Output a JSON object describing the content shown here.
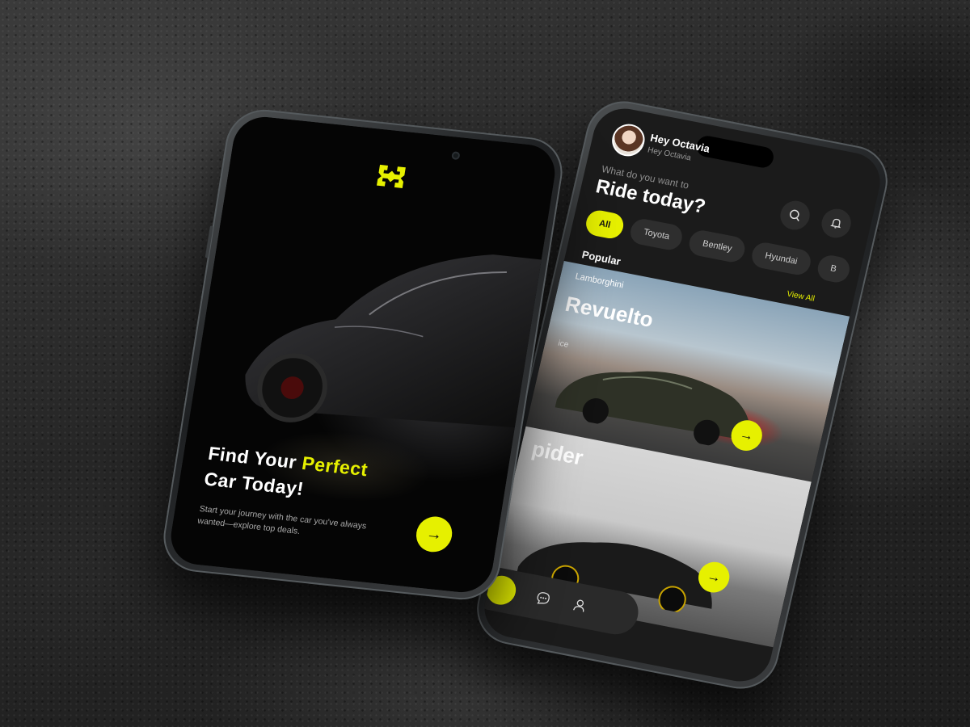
{
  "splash": {
    "title_part1": "Find Your ",
    "title_accent": "Perfect",
    "title_part2": "Car Today!",
    "subtitle": "Start your journey with the car you've always wanted—explore top deals.",
    "cta_icon": "arrow-right-icon",
    "cta_glyph": "→"
  },
  "home": {
    "greeting": "Hey Octavia",
    "greeting_sub": "Hey Octavia",
    "question_sub": "What do you want to",
    "question_title": "Ride today?",
    "search_icon": "search-icon",
    "bell_icon": "bell-icon",
    "chips": [
      {
        "label": "All",
        "active": true
      },
      {
        "label": "Toyota",
        "active": false
      },
      {
        "label": "Bentley",
        "active": false
      },
      {
        "label": "Hyundai",
        "active": false
      },
      {
        "label": "B",
        "active": false
      }
    ],
    "section_title": "Popular",
    "view_all": "View All",
    "cards": [
      {
        "brand": "Lamborghini",
        "model": "Revuelto",
        "spec": "ice",
        "cta_glyph": "→"
      },
      {
        "brand": "",
        "model": "pider",
        "spec": "",
        "cta_glyph": "→"
      }
    ],
    "nav": [
      {
        "icon": "home-icon"
      },
      {
        "icon": "chat-icon"
      },
      {
        "icon": "profile-icon"
      }
    ]
  },
  "colors": {
    "accent": "#e6f000",
    "screen_bg": "#1b1b1b",
    "chip_bg": "#2e2e2e"
  }
}
